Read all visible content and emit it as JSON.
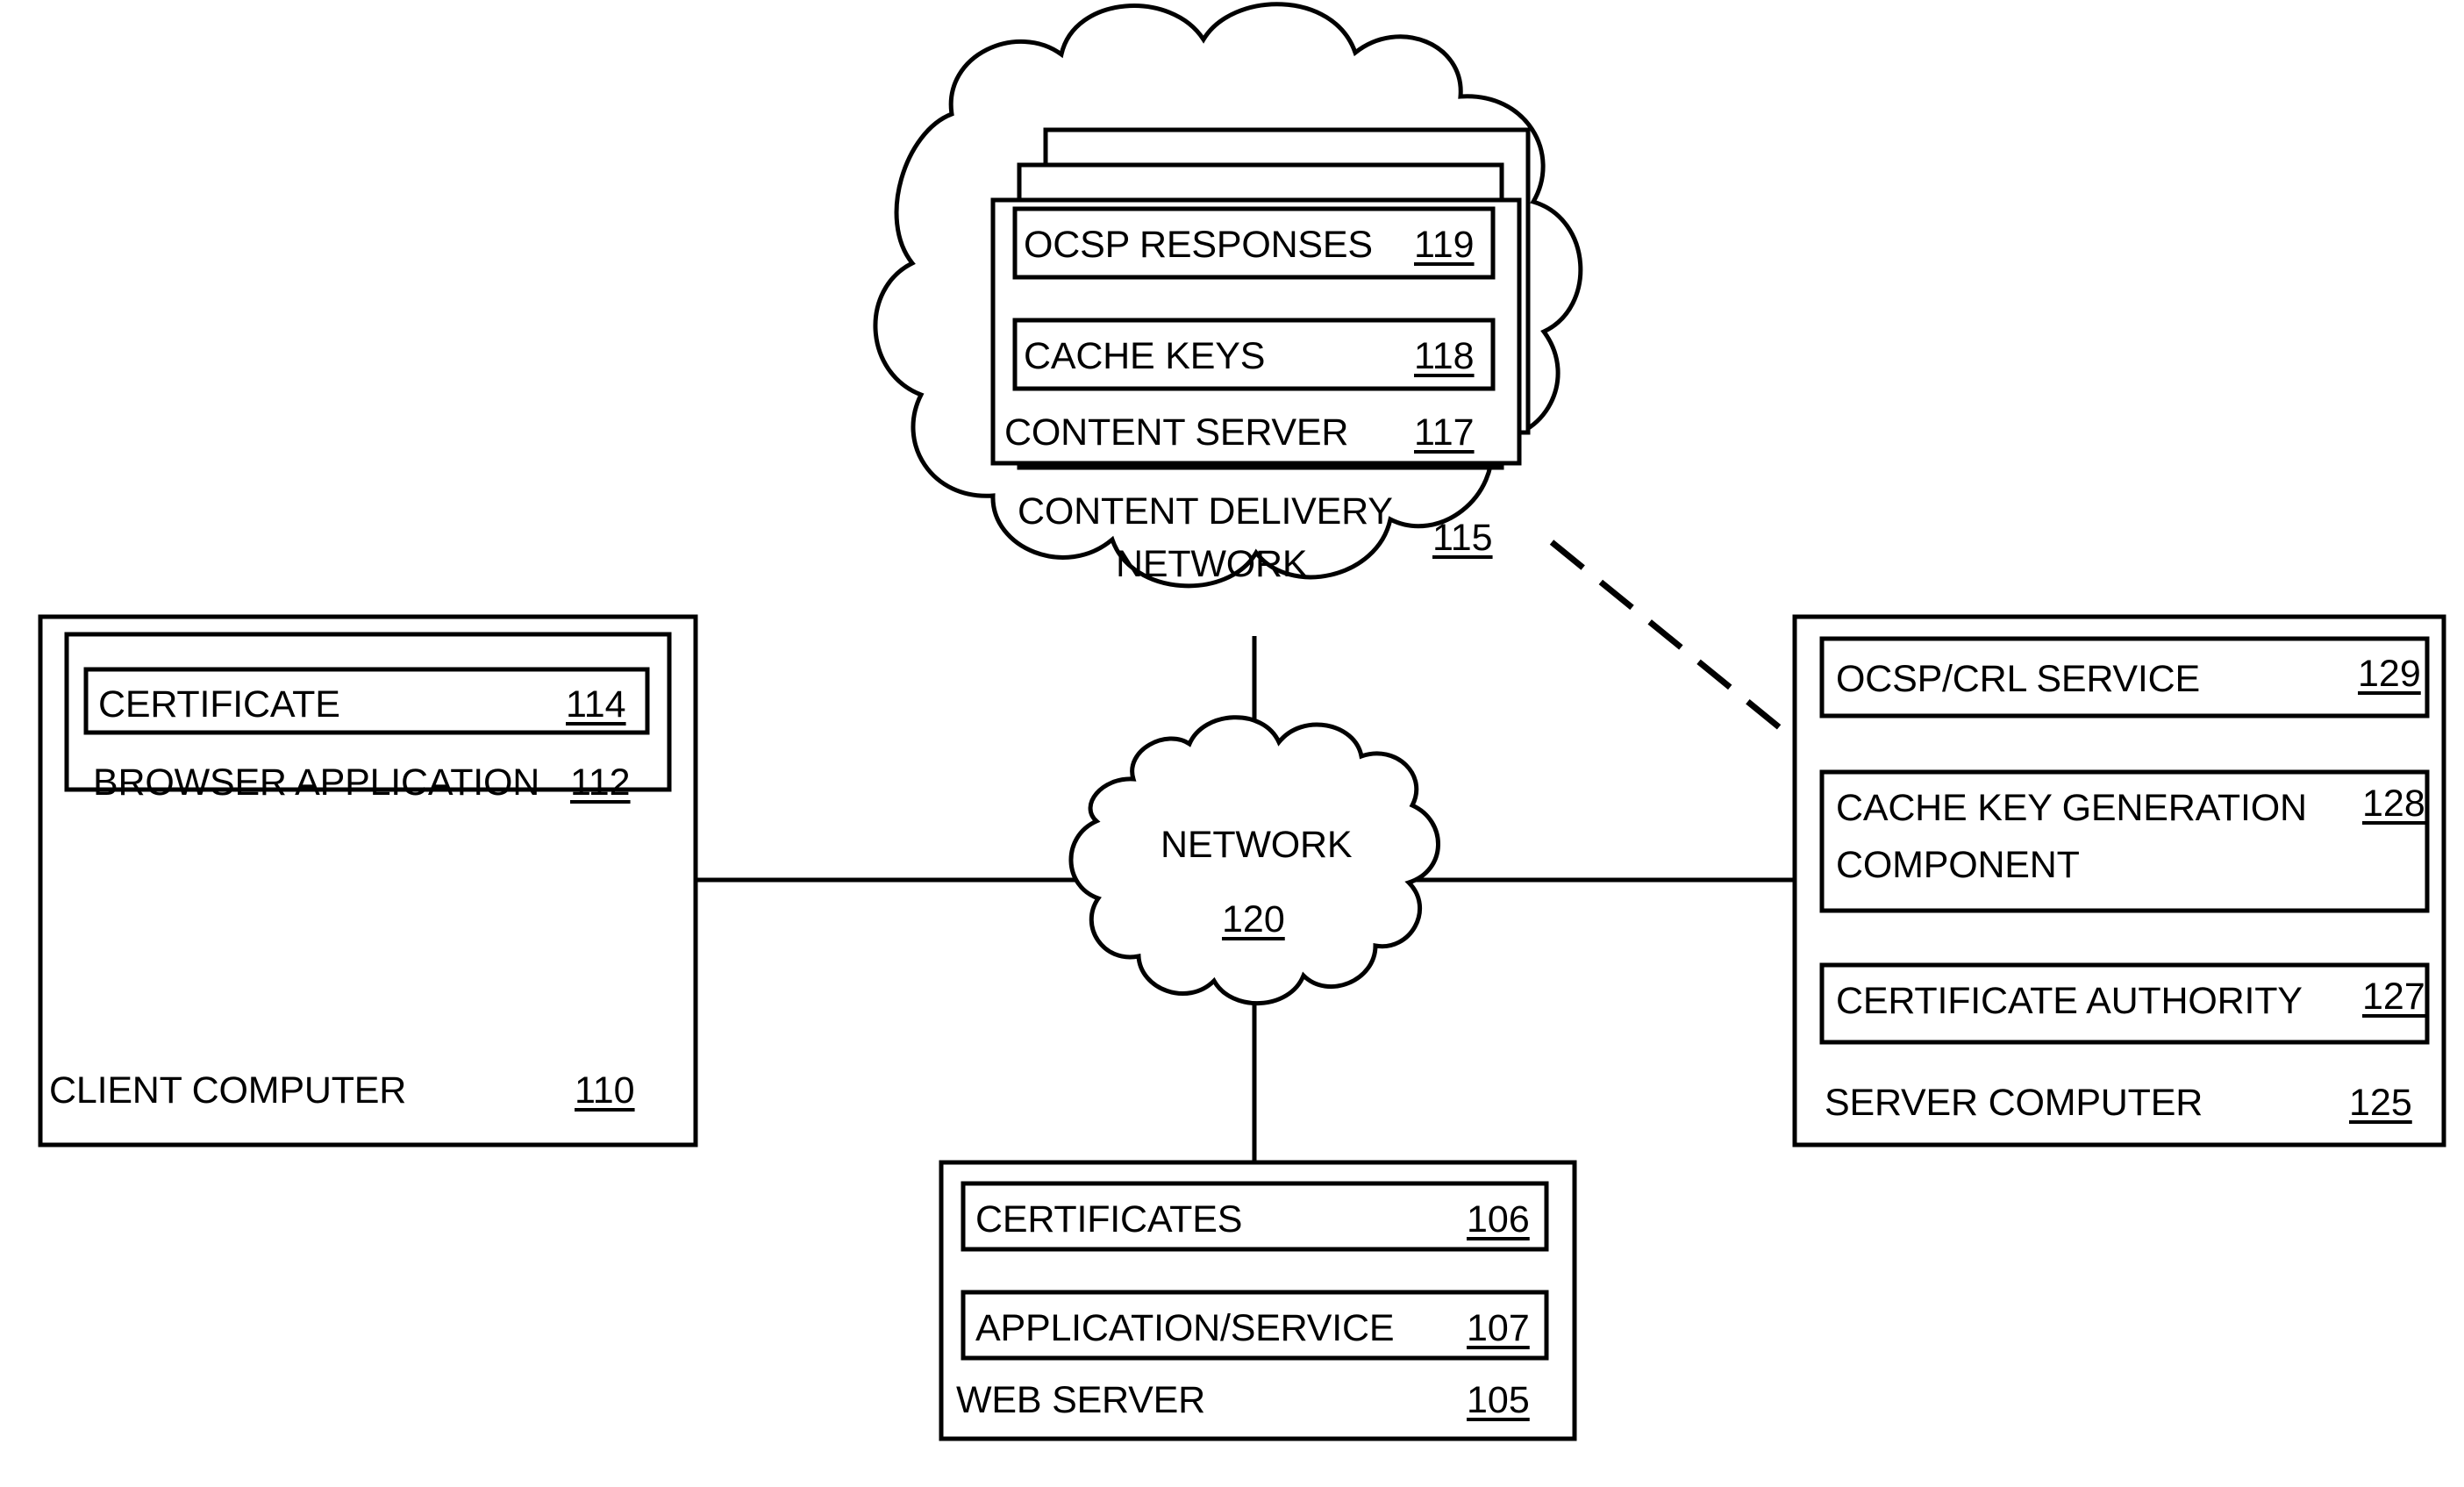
{
  "figure": {
    "type": "patent-network-architecture-diagram",
    "background_color": "#ffffff",
    "line_color": "#000000"
  },
  "cdn_cloud": {
    "name": "content-delivery-network",
    "title_line1": "CONTENT DELIVERY",
    "title_line2": "NETWORK",
    "ref": "115",
    "stacked_sheets": 3,
    "items": [
      {
        "label": "OCSP RESPONSES",
        "ref": "119",
        "boxed": true
      },
      {
        "label": "CACHE KEYS",
        "ref": "118",
        "boxed": true
      },
      {
        "label": "CONTENT SERVER",
        "ref": "117",
        "boxed": false
      }
    ]
  },
  "network_cloud": {
    "name": "network",
    "label": "NETWORK",
    "ref": "120"
  },
  "client_computer": {
    "name": "client-computer",
    "label": "CLIENT COMPUTER",
    "ref": "110",
    "inner_group": {
      "label": "BROWSER APPLICATION",
      "ref": "112",
      "items": [
        {
          "label": "CERTIFICATE",
          "ref": "114",
          "boxed": true
        }
      ]
    }
  },
  "web_server": {
    "name": "web-server",
    "label": "WEB SERVER",
    "ref": "105",
    "items": [
      {
        "label": "CERTIFICATES",
        "ref": "106",
        "boxed": true
      },
      {
        "label": "APPLICATION/SERVICE",
        "ref": "107",
        "boxed": true
      }
    ]
  },
  "server_computer": {
    "name": "server-computer",
    "label": "SERVER COMPUTER",
    "ref": "125",
    "items": [
      {
        "label": "OCSP/CRL SERVICE",
        "ref": "129",
        "boxed": true
      },
      {
        "label_line1": "CACHE KEY GENERATION",
        "label_line2": "COMPONENT",
        "ref": "128",
        "boxed": true
      },
      {
        "label": "CERTIFICATE AUTHORITY",
        "ref": "127",
        "boxed": true
      }
    ]
  },
  "connectors": [
    {
      "name": "client-to-network",
      "style": "solid"
    },
    {
      "name": "network-to-server",
      "style": "solid"
    },
    {
      "name": "cdn-to-network",
      "style": "solid"
    },
    {
      "name": "network-to-web-server",
      "style": "solid"
    },
    {
      "name": "cdn-to-server-computer",
      "style": "dashed"
    }
  ]
}
